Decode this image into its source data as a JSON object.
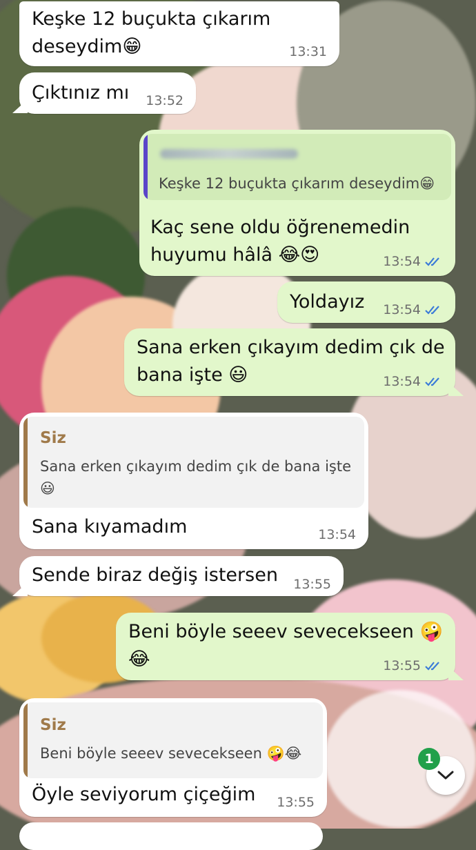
{
  "messages": [
    {
      "text": "Keşke 12 buçukta çıkarım\ndeseydim😁",
      "time": "13:31"
    },
    {
      "text": "Çıktınız mı",
      "time": "13:52"
    },
    {
      "quote_text": "Keşke 12 buçukta çıkarım deseydim😁",
      "text": "Kaç sene oldu öğrenemedin\nhuyumu hâlâ 😂😍",
      "time": "13:54"
    },
    {
      "text": "Yoldayız",
      "time": "13:54"
    },
    {
      "text": "Sana erken çıkayım dedim çık de\nbana işte 😃",
      "time": "13:54"
    },
    {
      "quote_sender": "Siz",
      "quote_text": "Sana erken çıkayım dedim çık de bana işte\n😃",
      "text": "Sana kıyamadım",
      "time": "13:54"
    },
    {
      "text": "Sende biraz değiş istersen",
      "time": "13:55"
    },
    {
      "text": "Beni böyle seeev sevecekseen 🤪\n😂",
      "time": "13:55"
    },
    {
      "quote_sender": "Siz",
      "quote_text": "Beni böyle seeev sevecekseen 🤪😂",
      "text": "Öyle seviyorum çiçeğim",
      "time": "13:55"
    }
  ],
  "unread_count": "1",
  "colors": {
    "incoming": "#ffffff",
    "outgoing": "#e2f7cb",
    "tick": "#3b7bd8",
    "quote_bar_out": "#5b45c9",
    "quote_bar_in": "#a07a4a",
    "badge": "#21a04a"
  },
  "icons": {
    "read_receipt": "double-check-icon",
    "scroll_down": "chevron-down-icon"
  }
}
